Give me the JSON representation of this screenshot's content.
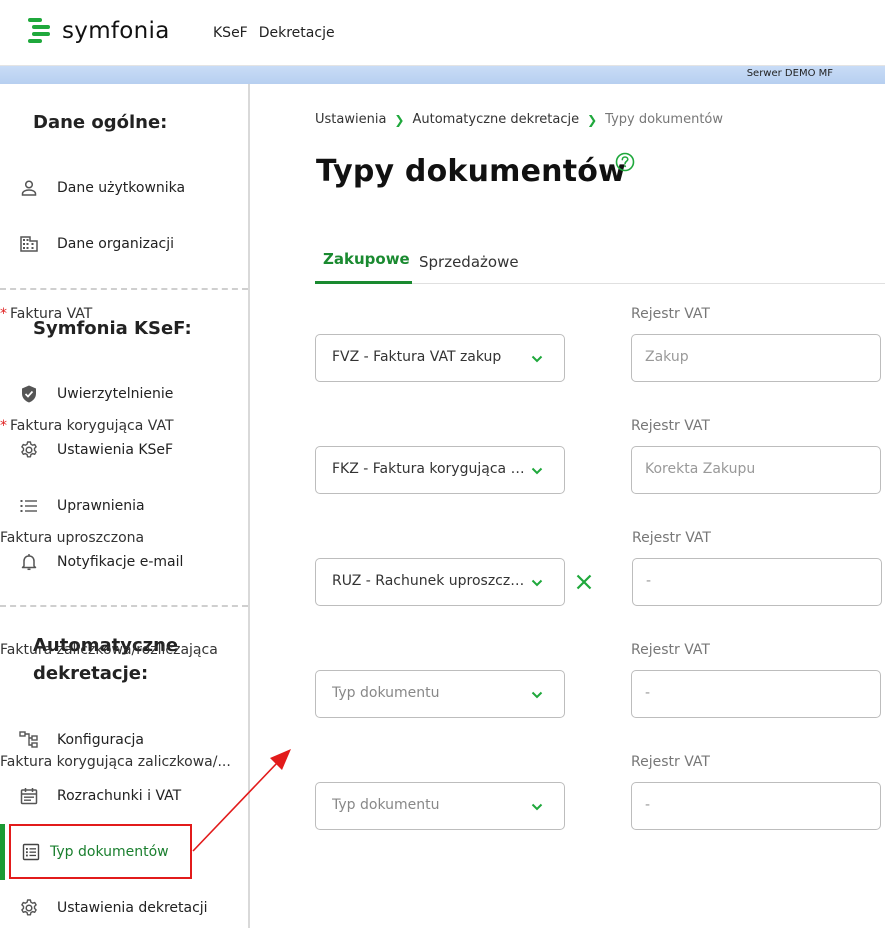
{
  "app": {
    "logo_text": "symfonia",
    "nav": [
      "KSeF",
      "Dekretacje"
    ],
    "server_label": "Serwer DEMO MF"
  },
  "sidebar": {
    "sections": [
      {
        "title": "Dane ogólne:"
      },
      {
        "title": "Symfonia KSeF:"
      },
      {
        "title": "Automatyczne dekretacje:"
      }
    ],
    "items": [
      {
        "label": "Dane użytkownika",
        "icon": "user-icon"
      },
      {
        "label": "Dane organizacji",
        "icon": "building-icon"
      },
      {
        "label": "Uwierzytelnienie",
        "icon": "shield-icon"
      },
      {
        "label": "Ustawienia KSeF",
        "icon": "gear-icon"
      },
      {
        "label": "Uprawnienia",
        "icon": "list-icon"
      },
      {
        "label": "Notyfikacje e-mail",
        "icon": "bell-icon"
      },
      {
        "label": "Konfiguracja",
        "icon": "hierarchy-icon"
      },
      {
        "label": "Rozrachunki i VAT",
        "icon": "calendar-icon"
      },
      {
        "label": "Typ dokumentów",
        "icon": "document-list-icon",
        "active": true
      },
      {
        "label": "Ustawienia dekretacji",
        "icon": "gear-icon"
      }
    ],
    "accent_color": "#1b9a34",
    "highlight_color": "#e21b1b"
  },
  "breadcrumb": [
    "Ustawienia",
    "Automatyczne dekretacje",
    "Typy dokumentów"
  ],
  "page": {
    "title": "Typy dokumentów"
  },
  "tabs": [
    {
      "label": "Zakupowe",
      "active": true
    },
    {
      "label": "Sprzedażowe",
      "active": false
    }
  ],
  "rows": [
    {
      "label": "Faktura VAT",
      "required": true,
      "value": "FVZ - Faktura VAT zakup",
      "placeholder": false,
      "register_label": "Rejestr VAT",
      "register_value": "Zakup",
      "clearable": false
    },
    {
      "label": "Faktura korygująca VAT",
      "required": true,
      "value": "FKZ - Faktura korygująca VAT zakup",
      "placeholder": false,
      "register_label": "Rejestr VAT",
      "register_value": "Korekta Zakupu",
      "clearable": false
    },
    {
      "label": "Faktura uproszczona",
      "required": false,
      "value": "RUZ - Rachunek uproszczony zakup",
      "placeholder": false,
      "register_label": "Rejestr VAT",
      "register_value": "-",
      "clearable": true
    },
    {
      "label": "Faktura zaliczkowa/rozliczająca",
      "required": false,
      "value": "Typ dokumentu",
      "placeholder": true,
      "register_label": "Rejestr VAT",
      "register_value": "-",
      "clearable": false
    },
    {
      "label": "Faktura korygująca zaliczkowa/...",
      "required": false,
      "value": "Typ dokumentu",
      "placeholder": true,
      "register_label": "Rejestr VAT",
      "register_value": "-",
      "clearable": false
    }
  ]
}
